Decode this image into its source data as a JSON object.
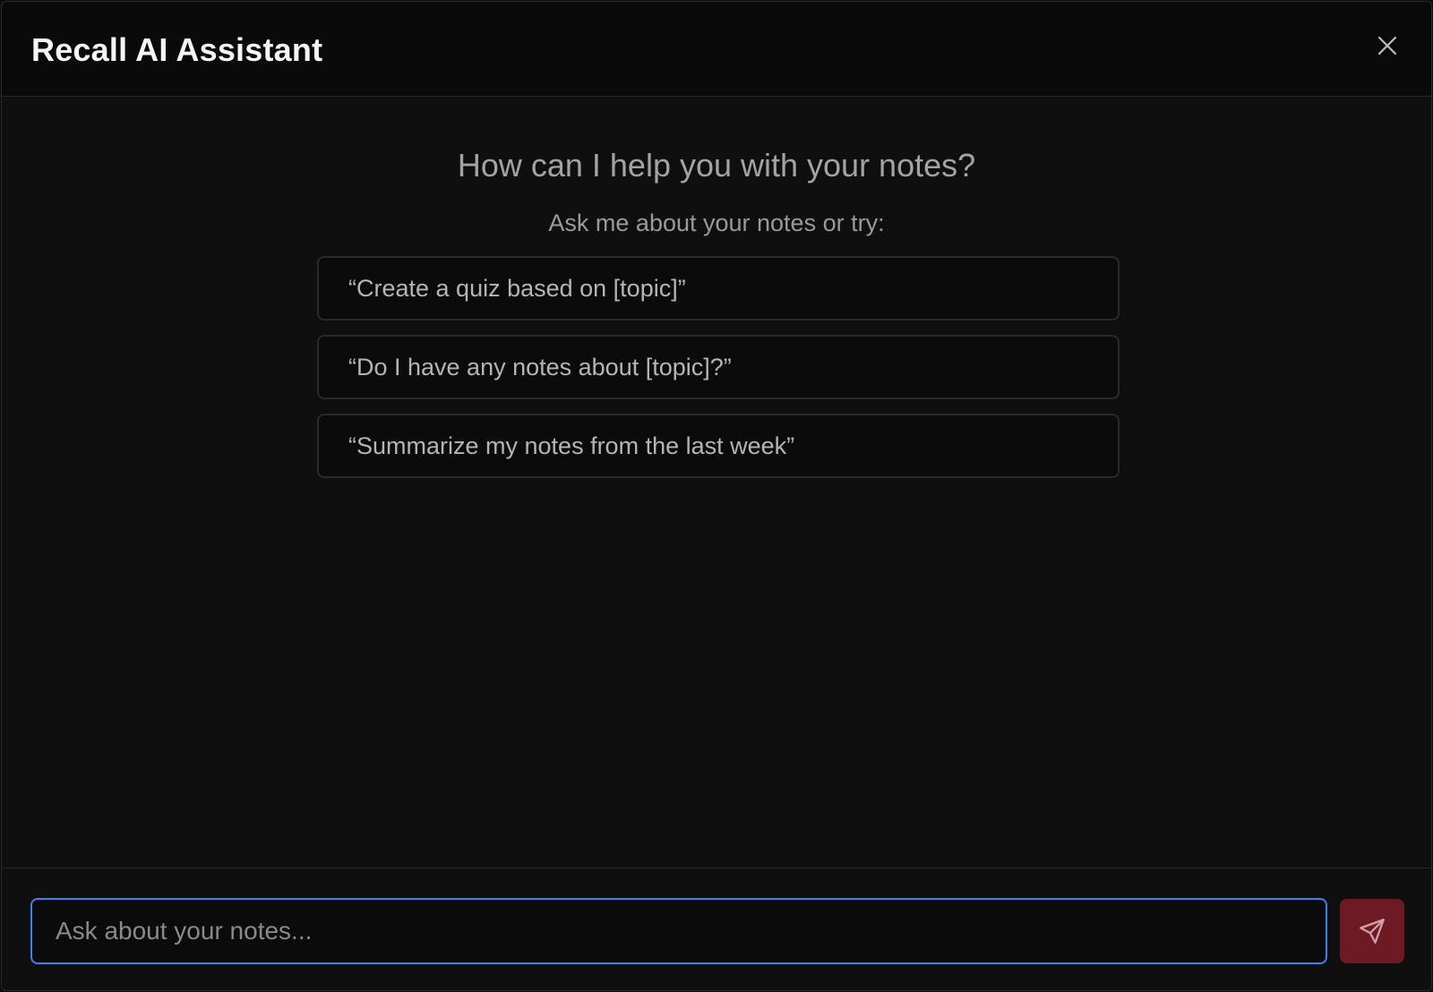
{
  "dialog": {
    "title": "Recall AI Assistant",
    "close_icon": "close-icon"
  },
  "main": {
    "heading": "How can I help you with your notes?",
    "subheading": "Ask me about your notes or try:",
    "suggestions": [
      "“Create a quiz based on [topic]”",
      "“Do I have any notes about [topic]?”",
      "“Summarize my notes from the last week”"
    ]
  },
  "footer": {
    "input_value": "",
    "input_placeholder": "Ask about your notes...",
    "send_icon": "send-icon"
  },
  "colors": {
    "background": "#0f0f0f",
    "input_focus_border": "#3b82f6",
    "send_button": "#6e1a24"
  }
}
